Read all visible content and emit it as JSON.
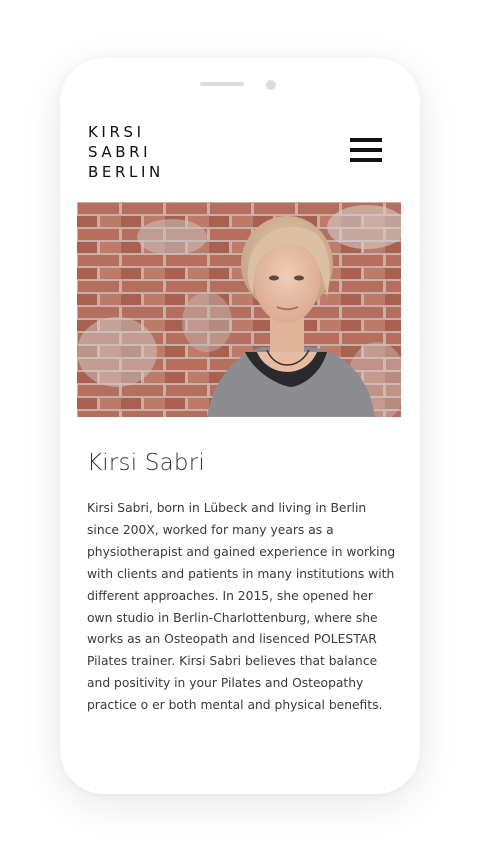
{
  "brand": {
    "line1": "KIRSI",
    "line2": "SABRI",
    "line3": "BERLIN"
  },
  "header": {
    "menu_icon": "hamburger-menu-icon"
  },
  "hero": {
    "alt": "Portrait of Kirsi Sabri in front of a brick wall"
  },
  "profile": {
    "name": "Kirsi Sabri",
    "bio": "Kirsi Sabri, born in Lübeck and living in Berlin since 200X, worked for many years as a physiotherapist and gained experience in working with clients and patients in many institutions with different approaches. In 2015, she opened her own studio in Berlin-Charlottenburg, where she works as an Osteopath and lisenced POLESTAR Pilates trainer. Kirsi Sabri believes that balance and positivity in your Pilates and Osteopathy practice o er both mental and physical benefits."
  },
  "colors": {
    "background": "#ffffff",
    "text": "#333333",
    "logo": "#111111"
  }
}
